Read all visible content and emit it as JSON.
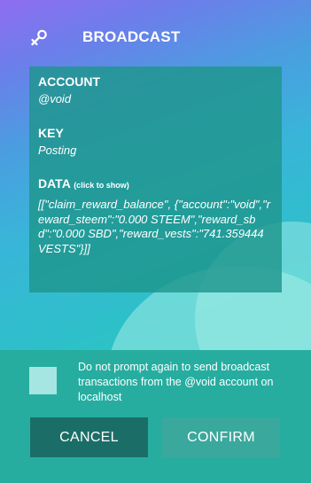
{
  "header": {
    "title": "BROADCAST"
  },
  "details": {
    "account_label": "ACCOUNT",
    "account_value": "@void",
    "key_label": "KEY",
    "key_value": "Posting",
    "data_label": "DATA",
    "data_hint": "(click to show)",
    "data_value": "[[\"claim_reward_balance\", {\"account\":\"void\",\"reward_steem\":\"0.000 STEEM\",\"reward_sbd\":\"0.000 SBD\",\"reward_vests\":\"741.359444 VESTS\"}]]"
  },
  "options": {
    "no_prompt_text": "Do not prompt again to send broadcast transactions from the @void account on localhost",
    "no_prompt_checked": false
  },
  "actions": {
    "cancel_label": "CANCEL",
    "confirm_label": "CONFIRM"
  },
  "icons": {
    "logo": "key-icon"
  },
  "colors": {
    "panel": "#1e968c",
    "cancel_button": "#1b6e67",
    "confirm_button": "#3aa89d",
    "checkbox": "#a6e6e2"
  }
}
